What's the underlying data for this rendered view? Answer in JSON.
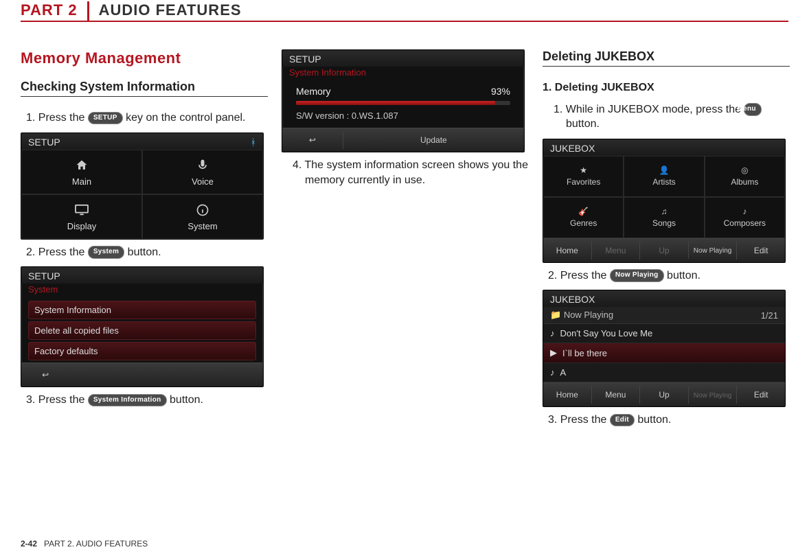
{
  "header": {
    "part": "PART 2",
    "title": "AUDIO FEATURES"
  },
  "col1": {
    "section": "Memory Management",
    "subhead": "Checking System Information",
    "step1_a": "1. Press the ",
    "step1_btn": "SETUP",
    "step1_b": " key on the control panel.",
    "shot1": {
      "title": "SETUP",
      "cells": [
        "Main",
        "Voice",
        "Display",
        "System"
      ]
    },
    "step2_a": "2. Press the ",
    "step2_btn": "System",
    "step2_b": " button.",
    "shot2": {
      "title": "SETUP",
      "sub": "System",
      "rows": [
        "System Information",
        "Delete all copied files",
        "Factory defaults"
      ]
    },
    "step3_a": "3. Press the ",
    "step3_btn": "System Information",
    "step3_b": " button."
  },
  "col2": {
    "shot3": {
      "title": "SETUP",
      "sub": "System Information",
      "mem_label": "Memory",
      "mem_pct": "93%",
      "version": "S/W version : 0.WS.1.087",
      "back": "↩",
      "update": "Update"
    },
    "step4": "4. The system information screen shows you the memory currently in use."
  },
  "col3": {
    "subhead": "Deleting JUKEBOX",
    "h1": "1. Deleting JUKEBOX",
    "step1_a": "1. While in JUKEBOX mode, press the ",
    "step1_btn": "Menu",
    "step1_b": " button.",
    "shot4": {
      "title": "JUKEBOX",
      "cells": [
        "Favorites",
        "Artists",
        "Albums",
        "Genres",
        "Songs",
        "Composers"
      ],
      "footer": [
        "Home",
        "Menu",
        "Up",
        "Now Playing",
        "Edit"
      ]
    },
    "step2_a": "2. Press the ",
    "step2_btn": "Now Playing",
    "step2_b": " button.",
    "shot5": {
      "title": "JUKEBOX",
      "np": "Now Playing",
      "count": "1/21",
      "tracks": [
        "Don't Say You Love Me",
        "I`ll be there",
        "A"
      ],
      "footer": [
        "Home",
        "Menu",
        "Up",
        "Now Playing",
        "Edit"
      ]
    },
    "step3_a": "3. Press the ",
    "step3_btn": "Edit",
    "step3_b": " button."
  },
  "footer": {
    "pagenum": "2-42",
    "label": "PART 2. AUDIO FEATURES"
  }
}
